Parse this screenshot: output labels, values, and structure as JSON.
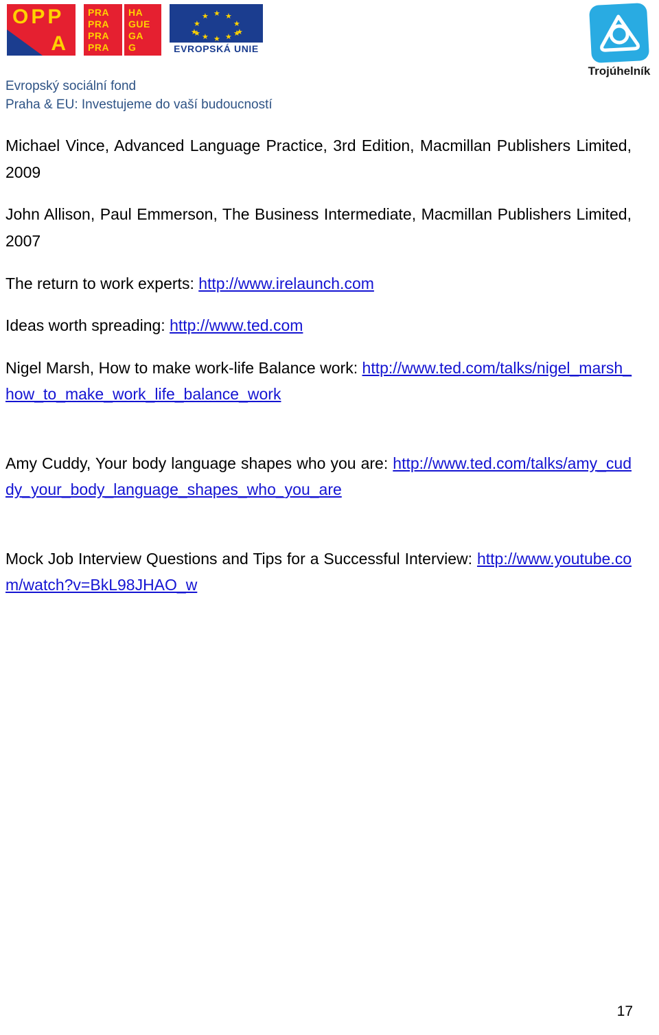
{
  "header": {
    "logos": {
      "oppa": {
        "name": "OPPA",
        "top_text": "OPP",
        "bottom_text": "A",
        "background_color": "#e52030",
        "text_color": "#ffd200",
        "corner_color": "#1b3d8f"
      },
      "prague": {
        "left_lines": [
          "PRA",
          "PRA",
          "PRA",
          "PRA"
        ],
        "right_lines": [
          "HA",
          "GUE",
          "GA",
          "G"
        ],
        "background_color": "#e52030",
        "text_color": "#ffd200"
      },
      "eu": {
        "caption": "EVROPSKÁ UNIE",
        "star_count": 12,
        "flag_color": "#1b3d8f",
        "star_color": "#ffd200",
        "caption_color": "#1b3d8f"
      },
      "trojuhelnik": {
        "caption": "Trojúhelník",
        "tile_color": "#29abe2",
        "mark_color": "#ffffff"
      }
    },
    "esf": {
      "line1": "Evropský sociální fond",
      "line2": "Praha & EU: Investujeme do vaší budoucností",
      "color": "#2e5385"
    }
  },
  "content": {
    "entries": [
      {
        "id": "entry-vince",
        "text": "Michael Vince, Advanced Language Practice, 3rd Edition, Macmillan Publishers Limited, 2009",
        "link_text": "",
        "link_href": ""
      },
      {
        "id": "entry-allison",
        "text": "John Allison, Paul Emmerson, The Business Intermediate, Macmillan Publishers Limited, 2007",
        "link_text": "",
        "link_href": ""
      },
      {
        "id": "entry-irelaunch",
        "text": "The return to work experts: ",
        "link_text": "http://www.irelaunch.com",
        "link_href": "http://www.irelaunch.com"
      },
      {
        "id": "entry-ted",
        "text": "Ideas worth spreading: ",
        "link_text": "http://www.ted.com",
        "link_href": "http://www.ted.com"
      },
      {
        "id": "entry-nigel-marsh",
        "text": "Nigel Marsh, How to make work-life Balance work: ",
        "link_text": "http://www.ted.com/talks/nigel_marsh_how_to_make_work_life_balance_work",
        "link_href": "http://www.ted.com/talks/nigel_marsh_how_to_make_work_life_balance_work"
      },
      {
        "id": "entry-amy-cuddy",
        "text": "Amy Cuddy, Your body language shapes who you are: ",
        "link_text": "http://www.ted.com/talks/amy_cuddy_your_body_language_shapes_who_you_are",
        "link_href": "http://www.ted.com/talks/amy_cuddy_your_body_language_shapes_who_you_are"
      },
      {
        "id": "entry-mock-interview",
        "text": "Mock Job Interview Questions and Tips for a Successful Interview: ",
        "link_text": "http://www.youtube.com/watch?v=BkL98JHAO_w",
        "link_href": "http://www.youtube.com/watch?v=BkL98JHAO_w"
      }
    ],
    "link_color": "#1414d2"
  },
  "footer": {
    "page_number": "17"
  }
}
